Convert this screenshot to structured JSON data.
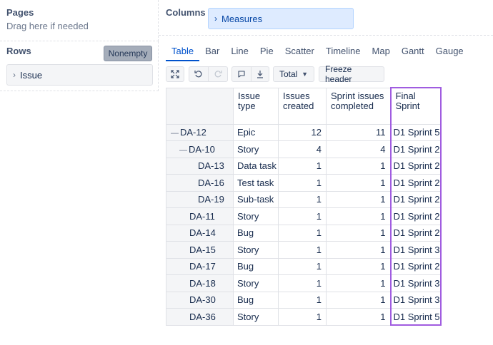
{
  "pages": {
    "title": "Pages",
    "hint": "Drag here if needed"
  },
  "rows": {
    "title": "Rows",
    "nonempty_label": "Nonempty",
    "dimension": "Issue"
  },
  "columns": {
    "title": "Columns",
    "dimension": "Measures"
  },
  "tabs": [
    "Table",
    "Bar",
    "Line",
    "Pie",
    "Scatter",
    "Timeline",
    "Map",
    "Gantt",
    "Gauge"
  ],
  "active_tab": "Table",
  "toolbar": {
    "total_label": "Total",
    "freeze_label": "Freeze header"
  },
  "table": {
    "headers": [
      "Issue type",
      "Issues created",
      "Sprint issues completed",
      "Final Sprint"
    ],
    "rows": [
      {
        "prefix": "—",
        "issue": "DA-12",
        "type": "Epic",
        "created": "12",
        "completed": "11",
        "sprint": "D1 Sprint 5"
      },
      {
        "prefix": "—",
        "issue": "DA-10",
        "type": "Story",
        "created": "4",
        "completed": "4",
        "sprint": "D1 Sprint 2"
      },
      {
        "prefix": "",
        "issue": "DA-13",
        "type": "Data task",
        "created": "1",
        "completed": "1",
        "sprint": "D1 Sprint 2"
      },
      {
        "prefix": "",
        "issue": "DA-16",
        "type": "Test task",
        "created": "1",
        "completed": "1",
        "sprint": "D1 Sprint 2"
      },
      {
        "prefix": "",
        "issue": "DA-19",
        "type": "Sub-task",
        "created": "1",
        "completed": "1",
        "sprint": "D1 Sprint 2"
      },
      {
        "prefix": "",
        "issue": "DA-11",
        "type": "Story",
        "created": "1",
        "completed": "1",
        "sprint": "D1 Sprint 2"
      },
      {
        "prefix": "",
        "issue": "DA-14",
        "type": "Bug",
        "created": "1",
        "completed": "1",
        "sprint": "D1 Sprint 2"
      },
      {
        "prefix": "",
        "issue": "DA-15",
        "type": "Story",
        "created": "1",
        "completed": "1",
        "sprint": "D1 Sprint 3"
      },
      {
        "prefix": "",
        "issue": "DA-17",
        "type": "Bug",
        "created": "1",
        "completed": "1",
        "sprint": "D1 Sprint 2"
      },
      {
        "prefix": "",
        "issue": "DA-18",
        "type": "Story",
        "created": "1",
        "completed": "1",
        "sprint": "D1 Sprint 3"
      },
      {
        "prefix": "",
        "issue": "DA-30",
        "type": "Bug",
        "created": "1",
        "completed": "1",
        "sprint": "D1 Sprint 3"
      },
      {
        "prefix": "",
        "issue": "DA-36",
        "type": "Story",
        "created": "1",
        "completed": "1",
        "sprint": "D1 Sprint 5"
      }
    ]
  },
  "colors": {
    "accent": "#0052cc",
    "highlight": "#a05ce0"
  }
}
